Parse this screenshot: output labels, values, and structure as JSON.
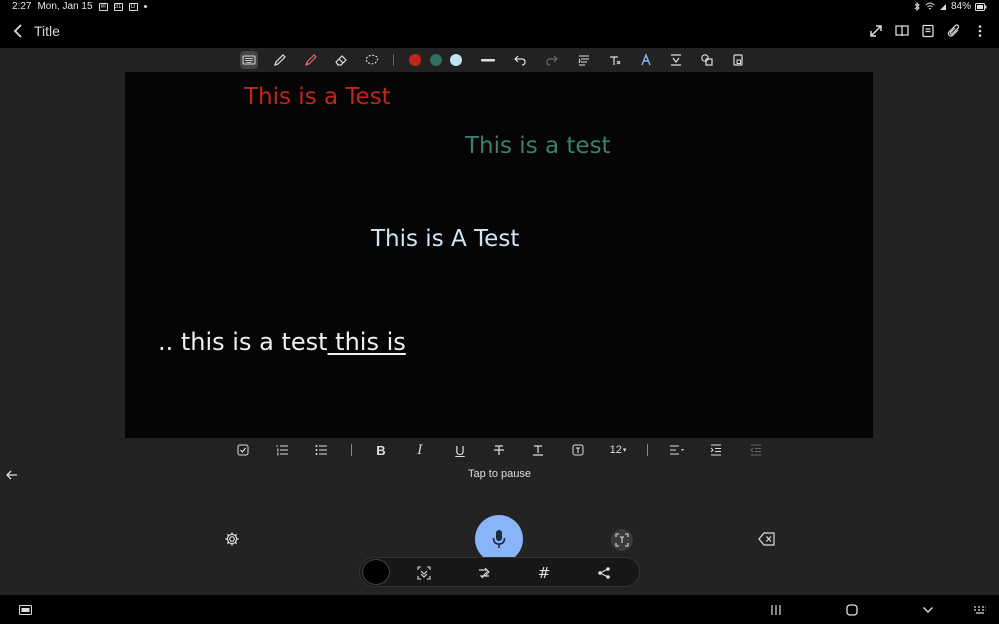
{
  "status_bar": {
    "time": "2:27",
    "date": "Mon, Jan 15",
    "battery": "84%",
    "notification_icons": [
      "gmail-icon",
      "calendar-icon",
      "outlook-icon"
    ]
  },
  "header": {
    "title": "Title"
  },
  "pen_colors": [
    "#c0261c",
    "#2f6f5f",
    "#bfe3f4"
  ],
  "canvas": {
    "notes": [
      {
        "text": "This is a Test",
        "color": "#c0261c"
      },
      {
        "text": "This is a test",
        "color": "#3b7f70"
      },
      {
        "text": "This is A Test",
        "color": "#cfe7f5"
      }
    ],
    "typed_line": {
      "text": ".. this is a test",
      "underlined": " this is",
      "color": "#f0f0f0"
    }
  },
  "format_bar": {
    "font_size": "12",
    "bold": "B",
    "italic": "I",
    "underline": "U"
  },
  "voice_panel": {
    "status": "Tap to pause",
    "mic_color": "#8ab4f8"
  }
}
